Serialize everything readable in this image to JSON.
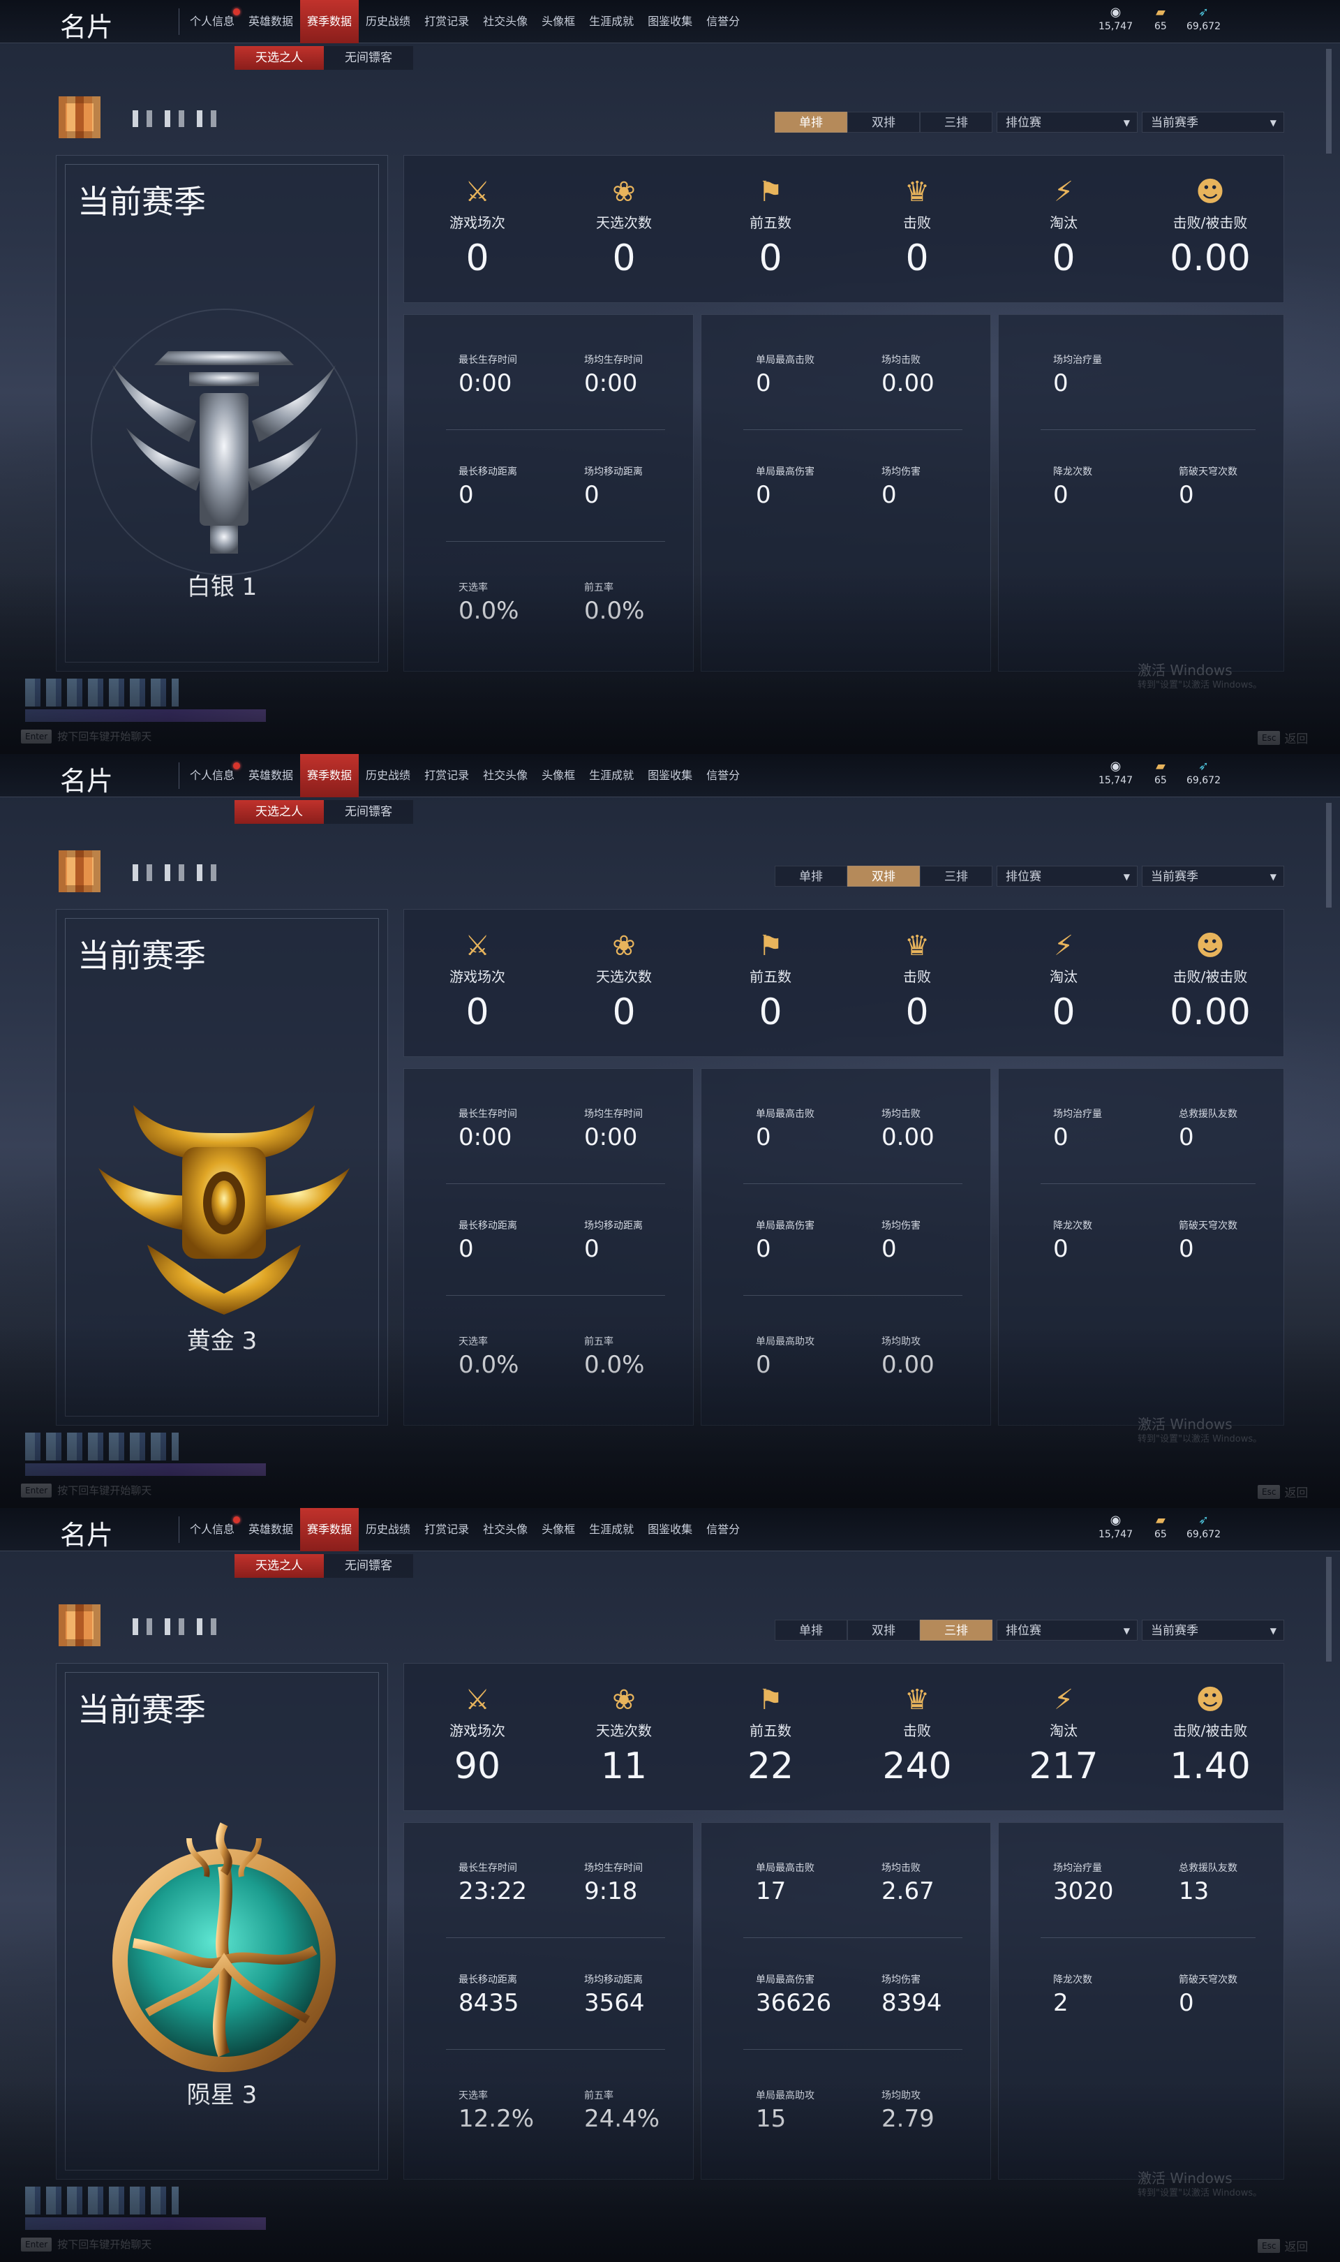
{
  "panels": [
    {
      "title": "名片",
      "tabs": [
        "个人信息",
        "英雄数据",
        "赛季数据",
        "历史战绩",
        "打赏记录",
        "社交头像",
        "头像框",
        "生涯成就",
        "图鉴收集",
        "信誉分"
      ],
      "active_tab": 2,
      "currency": [
        "15,747",
        "65",
        "69,672"
      ],
      "subtabs": [
        "天选之人",
        "无间镖客"
      ],
      "queue": [
        "单排",
        "双排",
        "三排"
      ],
      "active_queue": 0,
      "mode_dropdown": "排位赛",
      "season_dropdown": "当前赛季",
      "season_title": "当前赛季",
      "rank": "白银 1",
      "emblem": "silver",
      "top": [
        {
          "icon": "crossed-swords-icon",
          "glyph": "⚔",
          "label": "游戏场次",
          "value": "0"
        },
        {
          "icon": "lotus-icon",
          "glyph": "❀",
          "label": "天选次数",
          "value": "0"
        },
        {
          "icon": "sword-banner-icon",
          "glyph": "⚑",
          "label": "前五数",
          "value": "0"
        },
        {
          "icon": "crown-icon",
          "glyph": "♛",
          "label": "击败",
          "value": "0"
        },
        {
          "icon": "broken-blade-icon",
          "glyph": "⚡",
          "label": "淘汰",
          "value": "0"
        },
        {
          "icon": "mask-icon",
          "glyph": "☻",
          "label": "击败/被击败",
          "value": "0.00"
        }
      ],
      "d1": [
        [
          "最长生存时间",
          "0:00"
        ],
        [
          "场均生存时间",
          "0:00"
        ],
        [
          "最长移动距离",
          "0"
        ],
        [
          "场均移动距离",
          "0"
        ],
        [
          "天选率",
          "0.0%"
        ],
        [
          "前五率",
          "0.0%"
        ]
      ],
      "d2": [
        [
          "单局最高击败",
          "0"
        ],
        [
          "场均击败",
          "0.00"
        ],
        [
          "单局最高伤害",
          "0"
        ],
        [
          "场均伤害",
          "0"
        ]
      ],
      "d3": [
        [
          "场均治疗量",
          "0"
        ],
        [
          "降龙次数",
          "0"
        ],
        [
          "箭破天穹次数",
          "0"
        ]
      ],
      "activate": "激活 Windows",
      "activate_sub": "转到\"设置\"以激活 Windows。",
      "enter_key": "Enter",
      "enter_hint": "按下回车键开始聊天",
      "esc_key": "Esc",
      "esc_label": "返回"
    },
    {
      "title": "名片",
      "tabs": [
        "个人信息",
        "英雄数据",
        "赛季数据",
        "历史战绩",
        "打赏记录",
        "社交头像",
        "头像框",
        "生涯成就",
        "图鉴收集",
        "信誉分"
      ],
      "active_tab": 2,
      "currency": [
        "15,747",
        "65",
        "69,672"
      ],
      "subtabs": [
        "天选之人",
        "无间镖客"
      ],
      "queue": [
        "单排",
        "双排",
        "三排"
      ],
      "active_queue": 1,
      "mode_dropdown": "排位赛",
      "season_dropdown": "当前赛季",
      "season_title": "当前赛季",
      "rank": "黄金 3",
      "emblem": "gold",
      "top": [
        {
          "icon": "crossed-swords-icon",
          "glyph": "⚔",
          "label": "游戏场次",
          "value": "0"
        },
        {
          "icon": "lotus-icon",
          "glyph": "❀",
          "label": "天选次数",
          "value": "0"
        },
        {
          "icon": "sword-banner-icon",
          "glyph": "⚑",
          "label": "前五数",
          "value": "0"
        },
        {
          "icon": "crown-icon",
          "glyph": "♛",
          "label": "击败",
          "value": "0"
        },
        {
          "icon": "broken-blade-icon",
          "glyph": "⚡",
          "label": "淘汰",
          "value": "0"
        },
        {
          "icon": "mask-icon",
          "glyph": "☻",
          "label": "击败/被击败",
          "value": "0.00"
        }
      ],
      "d1": [
        [
          "最长生存时间",
          "0:00"
        ],
        [
          "场均生存时间",
          "0:00"
        ],
        [
          "最长移动距离",
          "0"
        ],
        [
          "场均移动距离",
          "0"
        ],
        [
          "天选率",
          "0.0%"
        ],
        [
          "前五率",
          "0.0%"
        ]
      ],
      "d2": [
        [
          "单局最高击败",
          "0"
        ],
        [
          "场均击败",
          "0.00"
        ],
        [
          "单局最高伤害",
          "0"
        ],
        [
          "场均伤害",
          "0"
        ],
        [
          "单局最高助攻",
          "0"
        ],
        [
          "场均助攻",
          "0.00"
        ]
      ],
      "d3": [
        [
          "场均治疗量",
          "0"
        ],
        [
          "总救援队友数",
          "0"
        ],
        [
          "降龙次数",
          "0"
        ],
        [
          "箭破天穹次数",
          "0"
        ]
      ],
      "activate": "激活 Windows",
      "activate_sub": "转到\"设置\"以激活 Windows。",
      "enter_key": "Enter",
      "enter_hint": "按下回车键开始聊天",
      "esc_key": "Esc",
      "esc_label": "返回"
    },
    {
      "title": "名片",
      "tabs": [
        "个人信息",
        "英雄数据",
        "赛季数据",
        "历史战绩",
        "打赏记录",
        "社交头像",
        "头像框",
        "生涯成就",
        "图鉴收集",
        "信誉分"
      ],
      "active_tab": 2,
      "currency": [
        "15,747",
        "65",
        "69,672"
      ],
      "subtabs": [
        "天选之人",
        "无间镖客"
      ],
      "queue": [
        "单排",
        "双排",
        "三排"
      ],
      "active_queue": 2,
      "mode_dropdown": "排位赛",
      "season_dropdown": "当前赛季",
      "season_title": "当前赛季",
      "rank": "陨星 3",
      "emblem": "meteor",
      "top": [
        {
          "icon": "crossed-swords-icon",
          "glyph": "⚔",
          "label": "游戏场次",
          "value": "90"
        },
        {
          "icon": "lotus-icon",
          "glyph": "❀",
          "label": "天选次数",
          "value": "11"
        },
        {
          "icon": "sword-banner-icon",
          "glyph": "⚑",
          "label": "前五数",
          "value": "22"
        },
        {
          "icon": "crown-icon",
          "glyph": "♛",
          "label": "击败",
          "value": "240"
        },
        {
          "icon": "broken-blade-icon",
          "glyph": "⚡",
          "label": "淘汰",
          "value": "217"
        },
        {
          "icon": "mask-icon",
          "glyph": "☻",
          "label": "击败/被击败",
          "value": "1.40"
        }
      ],
      "d1": [
        [
          "最长生存时间",
          "23:22"
        ],
        [
          "场均生存时间",
          "9:18"
        ],
        [
          "最长移动距离",
          "8435"
        ],
        [
          "场均移动距离",
          "3564"
        ],
        [
          "天选率",
          "12.2%"
        ],
        [
          "前五率",
          "24.4%"
        ]
      ],
      "d2": [
        [
          "单局最高击败",
          "17"
        ],
        [
          "场均击败",
          "2.67"
        ],
        [
          "单局最高伤害",
          "36626"
        ],
        [
          "场均伤害",
          "8394"
        ],
        [
          "单局最高助攻",
          "15"
        ],
        [
          "场均助攻",
          "2.79"
        ]
      ],
      "d3": [
        [
          "场均治疗量",
          "3020"
        ],
        [
          "总救援队友数",
          "13"
        ],
        [
          "降龙次数",
          "2"
        ],
        [
          "箭破天穹次数",
          "0"
        ]
      ],
      "activate": "激活 Windows",
      "activate_sub": "转到\"设置\"以激活 Windows。",
      "enter_key": "Enter",
      "enter_hint": "按下回车键开始聊天",
      "esc_key": "Esc",
      "esc_label": "返回"
    }
  ]
}
